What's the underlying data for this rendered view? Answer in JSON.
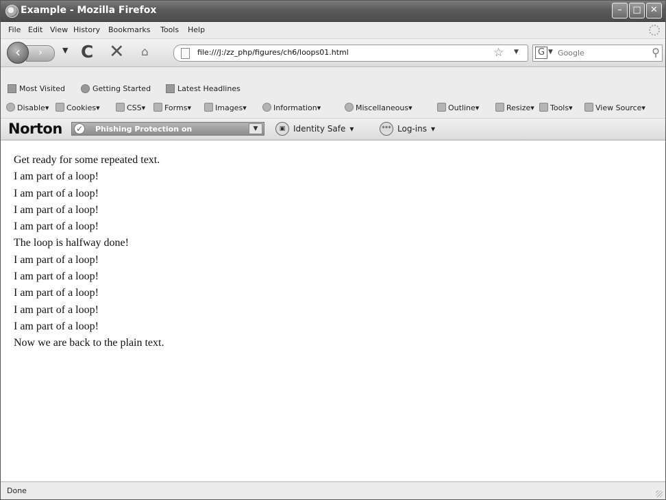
{
  "window": {
    "title": "Example - Mozilla Firefox",
    "controls": {
      "minimize": "–",
      "maximize": "□",
      "close": "✕"
    }
  },
  "menu": [
    "File",
    "Edit",
    "View",
    "History",
    "Bookmarks",
    "Tools",
    "Help"
  ],
  "nav": {
    "url": "file:///J:/zz_php/figures/ch6/loops01.html",
    "search_placeholder": "Google"
  },
  "bookmarks": [
    "Most Visited",
    "Getting Started",
    "Latest Headlines"
  ],
  "webdev": [
    "Disable",
    "Cookies",
    "CSS",
    "Forms",
    "Images",
    "Information",
    "Miscellaneous",
    "Outline",
    "Resize",
    "Tools",
    "View Source"
  ],
  "norton": {
    "brand": "Norton",
    "phishing_label": "Phishing Protection on",
    "identity_safe": "Identity Safe",
    "logins": "Log-ins",
    "logins_icon_text": "***"
  },
  "content_lines": [
    "Get ready for some repeated text.",
    "I am part of a loop!",
    "I am part of a loop!",
    "I am part of a loop!",
    "I am part of a loop!",
    "The loop is halfway done!",
    "I am part of a loop!",
    "I am part of a loop!",
    "I am part of a loop!",
    "I am part of a loop!",
    "I am part of a loop!",
    "Now we are back to the plain text."
  ],
  "status": "Done"
}
